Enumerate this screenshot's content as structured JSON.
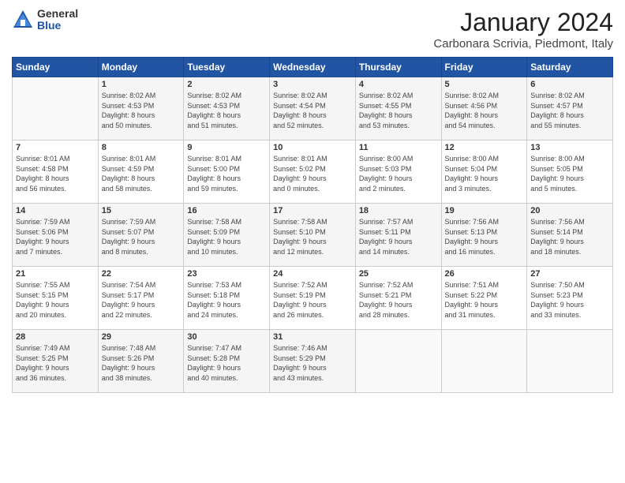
{
  "logo": {
    "general": "General",
    "blue": "Blue"
  },
  "title": "January 2024",
  "location": "Carbonara Scrivia, Piedmont, Italy",
  "days_header": [
    "Sunday",
    "Monday",
    "Tuesday",
    "Wednesday",
    "Thursday",
    "Friday",
    "Saturday"
  ],
  "weeks": [
    [
      {
        "day": "",
        "info": ""
      },
      {
        "day": "1",
        "info": "Sunrise: 8:02 AM\nSunset: 4:53 PM\nDaylight: 8 hours\nand 50 minutes."
      },
      {
        "day": "2",
        "info": "Sunrise: 8:02 AM\nSunset: 4:53 PM\nDaylight: 8 hours\nand 51 minutes."
      },
      {
        "day": "3",
        "info": "Sunrise: 8:02 AM\nSunset: 4:54 PM\nDaylight: 8 hours\nand 52 minutes."
      },
      {
        "day": "4",
        "info": "Sunrise: 8:02 AM\nSunset: 4:55 PM\nDaylight: 8 hours\nand 53 minutes."
      },
      {
        "day": "5",
        "info": "Sunrise: 8:02 AM\nSunset: 4:56 PM\nDaylight: 8 hours\nand 54 minutes."
      },
      {
        "day": "6",
        "info": "Sunrise: 8:02 AM\nSunset: 4:57 PM\nDaylight: 8 hours\nand 55 minutes."
      }
    ],
    [
      {
        "day": "7",
        "info": "Sunrise: 8:01 AM\nSunset: 4:58 PM\nDaylight: 8 hours\nand 56 minutes."
      },
      {
        "day": "8",
        "info": "Sunrise: 8:01 AM\nSunset: 4:59 PM\nDaylight: 8 hours\nand 58 minutes."
      },
      {
        "day": "9",
        "info": "Sunrise: 8:01 AM\nSunset: 5:00 PM\nDaylight: 8 hours\nand 59 minutes."
      },
      {
        "day": "10",
        "info": "Sunrise: 8:01 AM\nSunset: 5:02 PM\nDaylight: 9 hours\nand 0 minutes."
      },
      {
        "day": "11",
        "info": "Sunrise: 8:00 AM\nSunset: 5:03 PM\nDaylight: 9 hours\nand 2 minutes."
      },
      {
        "day": "12",
        "info": "Sunrise: 8:00 AM\nSunset: 5:04 PM\nDaylight: 9 hours\nand 3 minutes."
      },
      {
        "day": "13",
        "info": "Sunrise: 8:00 AM\nSunset: 5:05 PM\nDaylight: 9 hours\nand 5 minutes."
      }
    ],
    [
      {
        "day": "14",
        "info": "Sunrise: 7:59 AM\nSunset: 5:06 PM\nDaylight: 9 hours\nand 7 minutes."
      },
      {
        "day": "15",
        "info": "Sunrise: 7:59 AM\nSunset: 5:07 PM\nDaylight: 9 hours\nand 8 minutes."
      },
      {
        "day": "16",
        "info": "Sunrise: 7:58 AM\nSunset: 5:09 PM\nDaylight: 9 hours\nand 10 minutes."
      },
      {
        "day": "17",
        "info": "Sunrise: 7:58 AM\nSunset: 5:10 PM\nDaylight: 9 hours\nand 12 minutes."
      },
      {
        "day": "18",
        "info": "Sunrise: 7:57 AM\nSunset: 5:11 PM\nDaylight: 9 hours\nand 14 minutes."
      },
      {
        "day": "19",
        "info": "Sunrise: 7:56 AM\nSunset: 5:13 PM\nDaylight: 9 hours\nand 16 minutes."
      },
      {
        "day": "20",
        "info": "Sunrise: 7:56 AM\nSunset: 5:14 PM\nDaylight: 9 hours\nand 18 minutes."
      }
    ],
    [
      {
        "day": "21",
        "info": "Sunrise: 7:55 AM\nSunset: 5:15 PM\nDaylight: 9 hours\nand 20 minutes."
      },
      {
        "day": "22",
        "info": "Sunrise: 7:54 AM\nSunset: 5:17 PM\nDaylight: 9 hours\nand 22 minutes."
      },
      {
        "day": "23",
        "info": "Sunrise: 7:53 AM\nSunset: 5:18 PM\nDaylight: 9 hours\nand 24 minutes."
      },
      {
        "day": "24",
        "info": "Sunrise: 7:52 AM\nSunset: 5:19 PM\nDaylight: 9 hours\nand 26 minutes."
      },
      {
        "day": "25",
        "info": "Sunrise: 7:52 AM\nSunset: 5:21 PM\nDaylight: 9 hours\nand 28 minutes."
      },
      {
        "day": "26",
        "info": "Sunrise: 7:51 AM\nSunset: 5:22 PM\nDaylight: 9 hours\nand 31 minutes."
      },
      {
        "day": "27",
        "info": "Sunrise: 7:50 AM\nSunset: 5:23 PM\nDaylight: 9 hours\nand 33 minutes."
      }
    ],
    [
      {
        "day": "28",
        "info": "Sunrise: 7:49 AM\nSunset: 5:25 PM\nDaylight: 9 hours\nand 36 minutes."
      },
      {
        "day": "29",
        "info": "Sunrise: 7:48 AM\nSunset: 5:26 PM\nDaylight: 9 hours\nand 38 minutes."
      },
      {
        "day": "30",
        "info": "Sunrise: 7:47 AM\nSunset: 5:28 PM\nDaylight: 9 hours\nand 40 minutes."
      },
      {
        "day": "31",
        "info": "Sunrise: 7:46 AM\nSunset: 5:29 PM\nDaylight: 9 hours\nand 43 minutes."
      },
      {
        "day": "",
        "info": ""
      },
      {
        "day": "",
        "info": ""
      },
      {
        "day": "",
        "info": ""
      }
    ]
  ]
}
